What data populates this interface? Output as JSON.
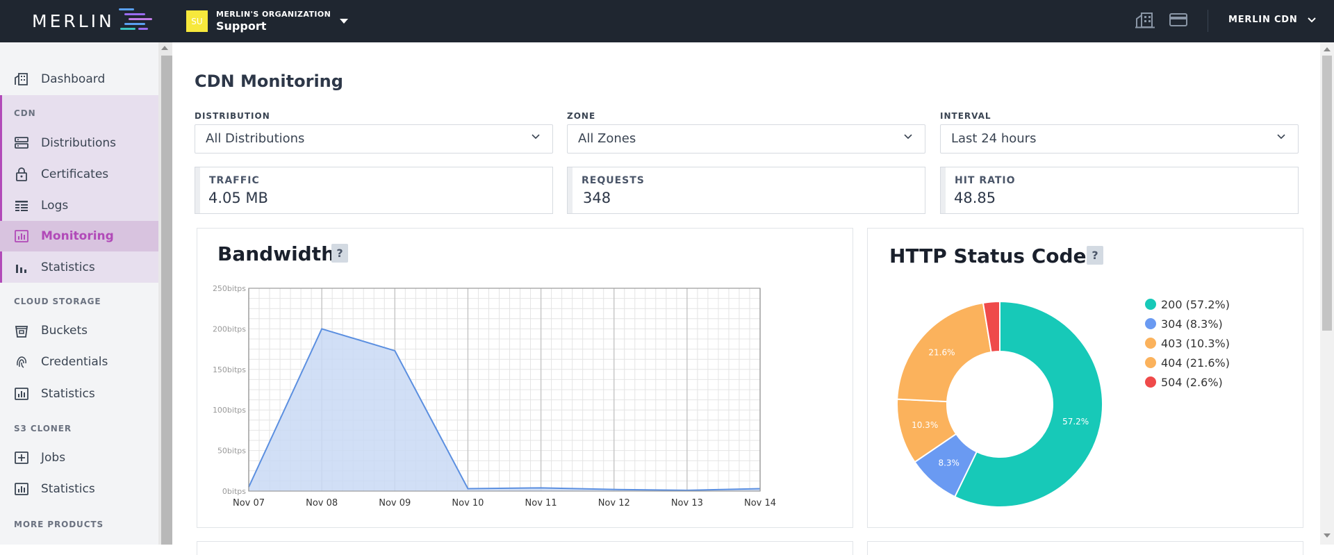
{
  "app": {
    "logo": "MERLIN",
    "org_title": "MERLIN'S ORGANIZATION",
    "org_name": "Support",
    "org_avatar": "SU",
    "account": "MERLIN CDN",
    "top_icons": [
      "building-icon",
      "credit-card-icon"
    ]
  },
  "sidebar": {
    "dashboard": "Dashboard",
    "sections": {
      "cdn": "CDN",
      "cloud_storage": "CLOUD STORAGE",
      "s3_cloner": "S3 CLONER",
      "more_products": "MORE PRODUCTS"
    },
    "cdn_items": [
      {
        "label": "Distributions",
        "icon": "server-icon"
      },
      {
        "label": "Certificates",
        "icon": "lock-icon"
      },
      {
        "label": "Logs",
        "icon": "logs-icon"
      },
      {
        "label": "Monitoring",
        "icon": "monitoring-icon",
        "active": true
      },
      {
        "label": "Statistics",
        "icon": "bar-chart-icon"
      }
    ],
    "storage_items": [
      {
        "label": "Buckets",
        "icon": "bucket-icon"
      },
      {
        "label": "Credentials",
        "icon": "fingerprint-icon"
      },
      {
        "label": "Statistics",
        "icon": "chart-box-icon"
      }
    ],
    "cloner_items": [
      {
        "label": "Jobs",
        "icon": "plus-box-icon"
      },
      {
        "label": "Statistics",
        "icon": "chart-box-icon"
      }
    ]
  },
  "page": {
    "title": "CDN Monitoring",
    "filters": {
      "distribution": {
        "label": "DISTRIBUTION",
        "value": "All Distributions"
      },
      "zone": {
        "label": "ZONE",
        "value": "All Zones"
      },
      "interval": {
        "label": "INTERVAL",
        "value": "Last 24 hours"
      }
    },
    "stats": {
      "traffic": {
        "label": "TRAFFIC",
        "value": "4.05 MB"
      },
      "requests": {
        "label": "REQUESTS",
        "value": "348"
      },
      "hit_ratio": {
        "label": "HIT RATIO",
        "value": "48.85"
      }
    },
    "bandwidth": {
      "title": "Bandwidth",
      "help": "?"
    },
    "status_codes": {
      "title": "HTTP Status Codes",
      "help": "?"
    }
  },
  "colors": {
    "topbar": "#1f2630",
    "accent": "#b14ab8",
    "area_fill": "#c9d9f5",
    "area_line": "#5b8fe0"
  },
  "chart_data": [
    {
      "type": "area",
      "title": "Bandwidth",
      "x": [
        "Nov 07",
        "Nov 08",
        "Nov 09",
        "Nov 10",
        "Nov 11",
        "Nov 12",
        "Nov 13",
        "Nov 14"
      ],
      "series": [
        {
          "values": [
            5,
            200,
            173,
            3,
            4,
            2,
            1,
            3
          ]
        }
      ],
      "yticks": [
        "0bitps",
        "50bitps",
        "100bitps",
        "150bitps",
        "200bitps",
        "250bitps"
      ],
      "ylim": [
        0,
        250
      ],
      "grid": true
    },
    {
      "type": "pie",
      "title": "HTTP Status Codes",
      "donut": true,
      "slices": [
        {
          "label": "200 (57.2%)",
          "value": 57.2,
          "display": "57.2%",
          "color": "#17c9b8"
        },
        {
          "label": "304 (8.3%)",
          "value": 8.3,
          "display": "8.3%",
          "color": "#6a9af2"
        },
        {
          "label": "403 (10.3%)",
          "value": 10.3,
          "display": "10.3%",
          "color": "#fbb25c"
        },
        {
          "label": "404 (21.6%)",
          "value": 21.6,
          "display": "21.6%",
          "color": "#fbb25c"
        },
        {
          "label": "504 (2.6%)",
          "value": 2.6,
          "display": "",
          "color": "#ef4a4a"
        }
      ],
      "legend": "right"
    }
  ]
}
